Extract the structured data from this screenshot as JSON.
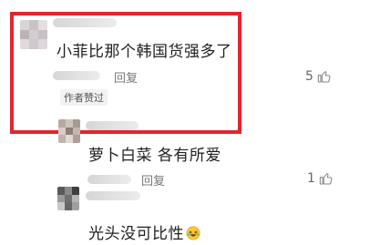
{
  "comments": [
    {
      "text": "小菲比那个韩国货强多了",
      "reply_label": "回复",
      "author_badge": "作者赞过",
      "likes": "5"
    },
    {
      "text": "萝卜白菜 各有所爱",
      "reply_label": "",
      "likes": ""
    },
    {
      "text": "光头没可比性",
      "reply_label": "回复",
      "likes": "1",
      "emoji": "laughing-tears-emoji"
    }
  ],
  "colors": {
    "highlight": "#e1262c",
    "text": "#1f1f1f",
    "meta": "#777777"
  }
}
